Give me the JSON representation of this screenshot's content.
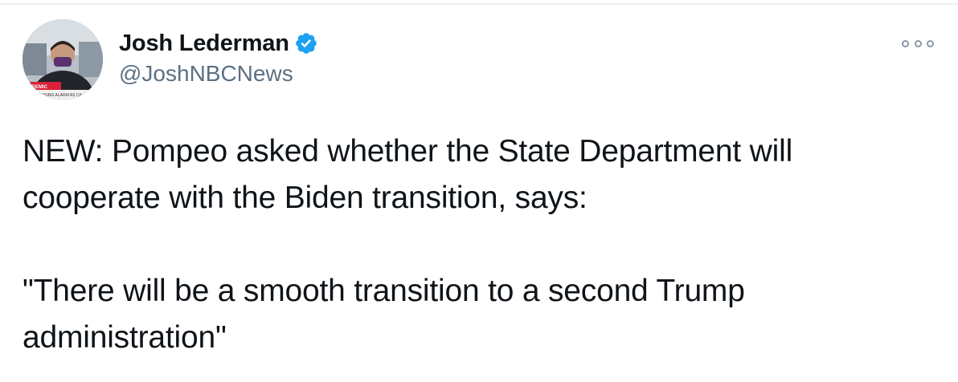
{
  "tweet": {
    "author": {
      "display_name": "Josh Lederman",
      "handle": "@JoshNBCNews",
      "verified": true,
      "avatar_icon": "profile-photo",
      "avatar_text": "ANDEMIC",
      "avatar_ticker": "CIALS RAISING ALARM AS CA"
    },
    "menu_icon": "more-options-icon",
    "text": {
      "line1": "NEW: Pompeo asked whether the State Department will",
      "line2": "cooperate with the Biden transition, says:",
      "line3": "\"There will be a smooth transition to a second Trump",
      "line4": "administration\""
    },
    "colors": {
      "text": "#0f1419",
      "secondary": "#5b7083",
      "verified": "#1da1f2"
    }
  }
}
